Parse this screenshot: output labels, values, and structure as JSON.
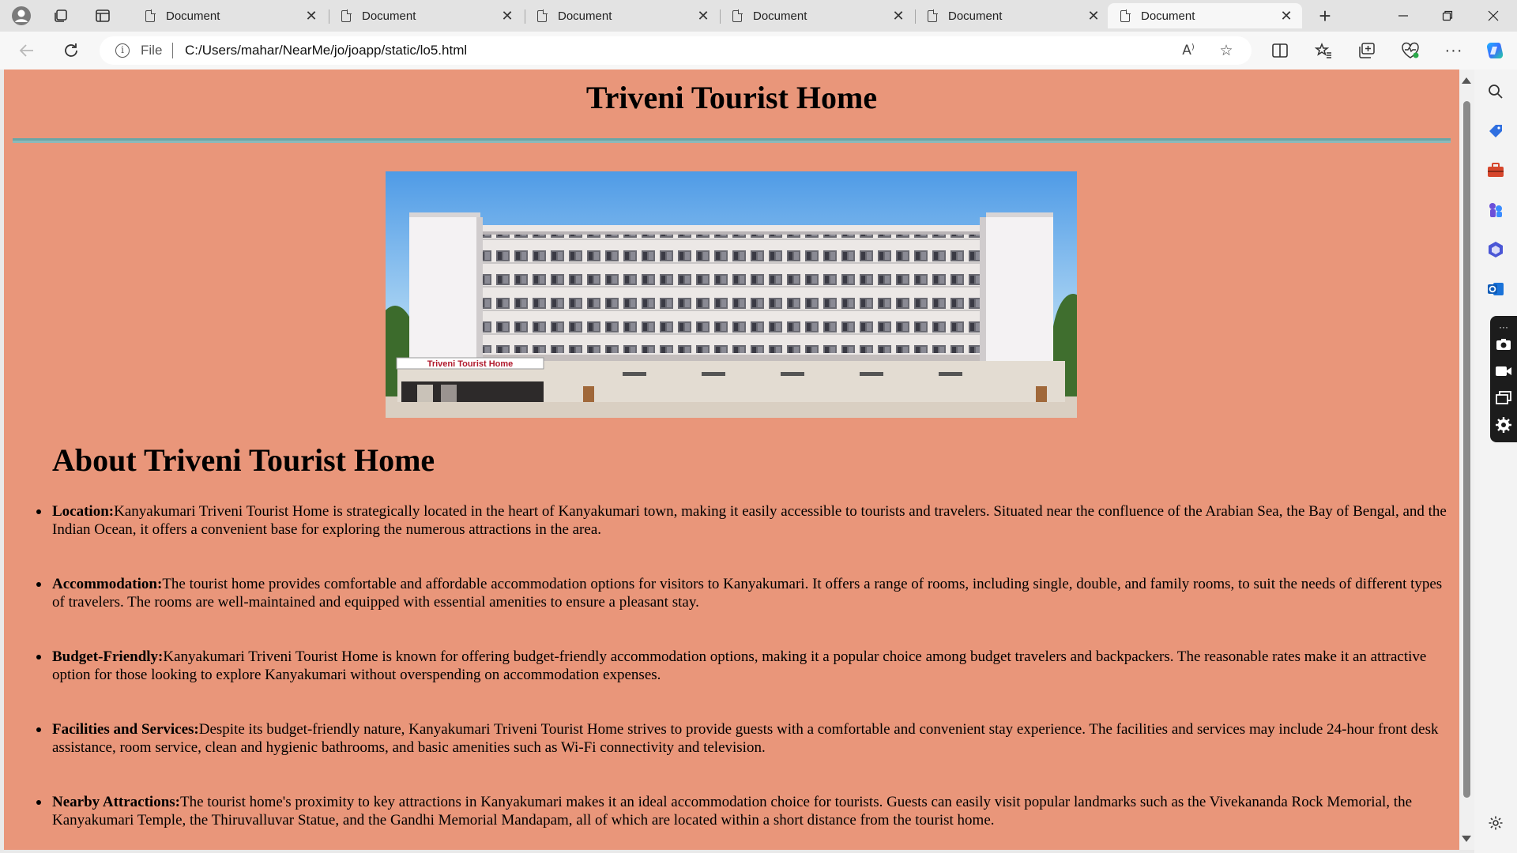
{
  "browser": {
    "tabs": [
      {
        "label": "Document",
        "active": false
      },
      {
        "label": "Document",
        "active": false
      },
      {
        "label": "Document",
        "active": false
      },
      {
        "label": "Document",
        "active": false
      },
      {
        "label": "Document",
        "active": false
      },
      {
        "label": "Document",
        "active": true
      }
    ],
    "address_bar": {
      "scheme_label": "File",
      "url": "C:/Users/mahar/NearMe/jo/joapp/static/lo5.html"
    },
    "icons": [
      "profile-icon",
      "workspaces-icon",
      "tab-actions-icon",
      "new-tab-icon",
      "minimize-icon",
      "maximize-icon",
      "close-window-icon",
      "back-icon",
      "refresh-icon",
      "info-icon",
      "read-aloud-icon",
      "favorite-star-icon",
      "split-screen-icon",
      "favorites-icon",
      "collections-icon",
      "browser-essentials-icon",
      "more-icon",
      "copilot-icon"
    ]
  },
  "page": {
    "title": "Triveni Tourist Home",
    "about_heading": "About Triveni Tourist Home",
    "hero_sign_text": "Triveni Tourist Home",
    "items": [
      {
        "label": "Location:",
        "text": "Kanyakumari Triveni Tourist Home is strategically located in the heart of Kanyakumari town, making it easily accessible to tourists and travelers. Situated near the confluence of the Arabian Sea, the Bay of Bengal, and the Indian Ocean, it offers a convenient base for exploring the numerous attractions in the area."
      },
      {
        "label": "Accommodation:",
        "text": "The tourist home provides comfortable and affordable accommodation options for visitors to Kanyakumari. It offers a range of rooms, including single, double, and family rooms, to suit the needs of different types of travelers. The rooms are well-maintained and equipped with essential amenities to ensure a pleasant stay."
      },
      {
        "label": "Budget-Friendly:",
        "text": "Kanyakumari Triveni Tourist Home is known for offering budget-friendly accommodation options, making it a popular choice among budget travelers and backpackers. The reasonable rates make it an attractive option for those looking to explore Kanyakumari without overspending on accommodation expenses."
      },
      {
        "label": "Facilities and Services:",
        "text": "Despite its budget-friendly nature, Kanyakumari Triveni Tourist Home strives to provide guests with a comfortable and convenient stay experience. The facilities and services may include 24-hour front desk assistance, room service, clean and hygienic bathrooms, and basic amenities such as Wi-Fi connectivity and television."
      },
      {
        "label": "Nearby Attractions:",
        "text": "The tourist home's proximity to key attractions in Kanyakumari makes it an ideal accommodation choice for tourists. Guests can easily visit popular landmarks such as the Vivekananda Rock Memorial, the Kanyakumari Temple, the Thiruvalluvar Statue, and the Gandhi Memorial Mandapam, all of which are located within a short distance from the tourist home."
      }
    ]
  },
  "colors": {
    "page_background": "#e9967a",
    "title_rule": "#6aa6a6",
    "browser_chrome": "#e3e3e3",
    "toolbar": "#f7f7f7"
  }
}
